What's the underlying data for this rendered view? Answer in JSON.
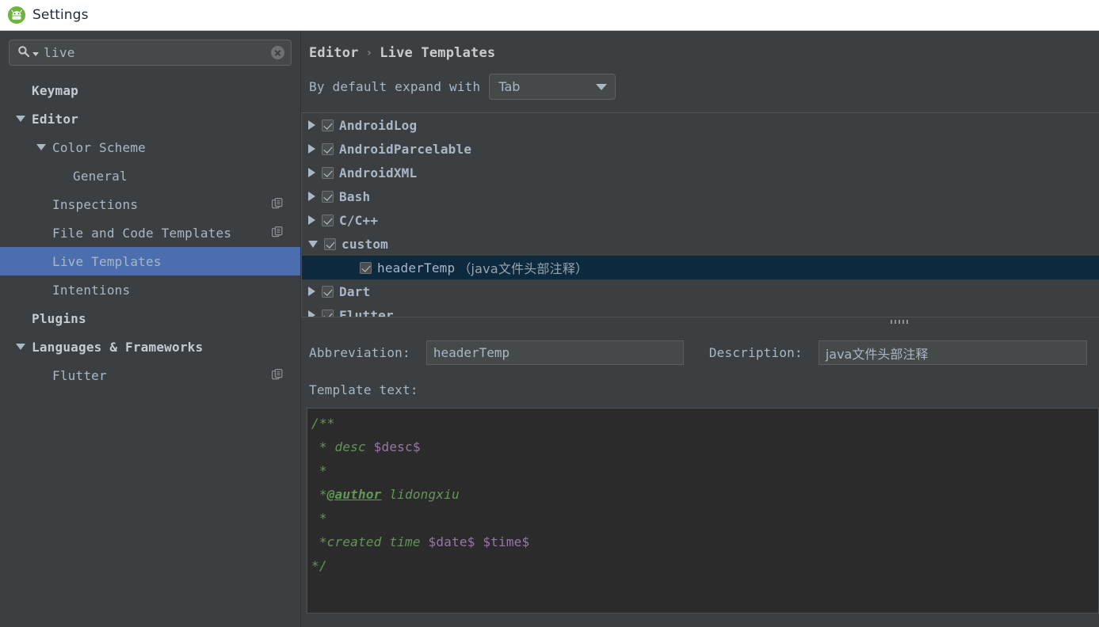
{
  "window": {
    "title": "Settings",
    "app_icon": "android-studio-icon",
    "accent_green": "#6DB33F"
  },
  "sidebar": {
    "search": {
      "value": "live",
      "icon": "search-icon",
      "clear_icon": "clear-icon"
    },
    "items": [
      {
        "label": "Keymap",
        "indent": 0,
        "twisty": "none",
        "bold": true,
        "selected": false,
        "copy_icon": false
      },
      {
        "label": "Editor",
        "indent": 0,
        "twisty": "open",
        "bold": true,
        "selected": false,
        "copy_icon": false
      },
      {
        "label": "Color Scheme",
        "indent": 1,
        "twisty": "open",
        "bold": false,
        "selected": false,
        "copy_icon": false
      },
      {
        "label": "General",
        "indent": 2,
        "twisty": "none",
        "bold": false,
        "selected": false,
        "copy_icon": false
      },
      {
        "label": "Inspections",
        "indent": 1,
        "twisty": "none",
        "bold": false,
        "selected": false,
        "copy_icon": true
      },
      {
        "label": "File and Code Templates",
        "indent": 1,
        "twisty": "none",
        "bold": false,
        "selected": false,
        "copy_icon": true
      },
      {
        "label": "Live Templates",
        "indent": 1,
        "twisty": "none",
        "bold": false,
        "selected": true,
        "copy_icon": false
      },
      {
        "label": "Intentions",
        "indent": 1,
        "twisty": "none",
        "bold": false,
        "selected": false,
        "copy_icon": false
      },
      {
        "label": "Plugins",
        "indent": 0,
        "twisty": "none",
        "bold": true,
        "selected": false,
        "copy_icon": false
      },
      {
        "label": "Languages & Frameworks",
        "indent": 0,
        "twisty": "open",
        "bold": true,
        "selected": false,
        "copy_icon": false
      },
      {
        "label": "Flutter",
        "indent": 1,
        "twisty": "none",
        "bold": false,
        "selected": false,
        "copy_icon": true
      }
    ],
    "selection_color": "#4B6EAF"
  },
  "main": {
    "breadcrumb": {
      "parent": "Editor",
      "separator": "›",
      "current": "Live Templates"
    },
    "expand_with": {
      "label": "By default expand with",
      "value": "Tab",
      "icon": "chevron-down-icon"
    },
    "templates": [
      {
        "name": "AndroidLog",
        "desc": "",
        "arrow": "closed",
        "checked": true,
        "leaf": false,
        "selected": false
      },
      {
        "name": "AndroidParcelable",
        "desc": "",
        "arrow": "closed",
        "checked": true,
        "leaf": false,
        "selected": false
      },
      {
        "name": "AndroidXML",
        "desc": "",
        "arrow": "closed",
        "checked": true,
        "leaf": false,
        "selected": false
      },
      {
        "name": "Bash",
        "desc": "",
        "arrow": "closed",
        "checked": true,
        "leaf": false,
        "selected": false
      },
      {
        "name": "C/C++",
        "desc": "",
        "arrow": "closed",
        "checked": true,
        "leaf": false,
        "selected": false
      },
      {
        "name": "custom",
        "desc": "",
        "arrow": "open",
        "checked": true,
        "leaf": false,
        "selected": false
      },
      {
        "name": "headerTemp",
        "desc": "（java文件头部注释）",
        "arrow": "blank",
        "checked": true,
        "leaf": true,
        "selected": true
      },
      {
        "name": "Dart",
        "desc": "",
        "arrow": "closed",
        "checked": true,
        "leaf": false,
        "selected": false
      },
      {
        "name": "Flutter",
        "desc": "",
        "arrow": "closed",
        "checked": true,
        "leaf": false,
        "selected": false
      }
    ],
    "tree_selection_color": "#0D293E",
    "abbreviation": {
      "label": "Abbreviation:",
      "value": "headerTemp"
    },
    "description": {
      "label": "Description:",
      "value": "java文件头部注释"
    },
    "template_text_label": "Template text:",
    "editor": {
      "comment_color": "#629755",
      "variable_color": "#9876AA",
      "background": "#2B2B2B",
      "lines": [
        {
          "parts": [
            {
              "t": "/**",
              "k": "c"
            }
          ]
        },
        {
          "parts": [
            {
              "t": " * desc ",
              "k": "c"
            },
            {
              "t": "$desc$",
              "k": "v"
            }
          ]
        },
        {
          "parts": [
            {
              "t": " *",
              "k": "c"
            }
          ]
        },
        {
          "parts": [
            {
              "t": " *",
              "k": "c"
            },
            {
              "t": "@author",
              "k": "g"
            },
            {
              "t": " lidongxiu",
              "k": "c"
            }
          ]
        },
        {
          "parts": [
            {
              "t": " *",
              "k": "c"
            }
          ]
        },
        {
          "parts": [
            {
              "t": " *created time ",
              "k": "c"
            },
            {
              "t": "$date$",
              "k": "v"
            },
            {
              "t": " ",
              "k": "c"
            },
            {
              "t": "$time$",
              "k": "v"
            }
          ]
        },
        {
          "parts": [
            {
              "t": "*/",
              "k": "c"
            }
          ]
        }
      ]
    },
    "splitter_grip": "drag-handle"
  }
}
